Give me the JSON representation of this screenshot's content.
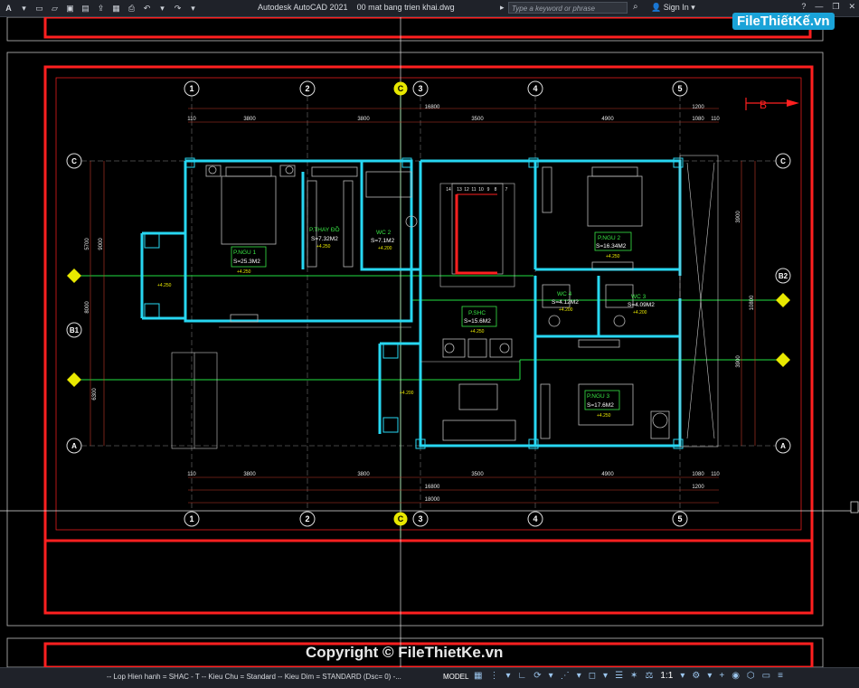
{
  "app": {
    "title": "Autodesk AutoCAD 2021",
    "filename": "00 mat bang trien khai.dwg",
    "search_placeholder": "Type a keyword or phrase",
    "sign_in": "Sign In"
  },
  "watermark": {
    "brand": "FileThiếtKế.vn",
    "copyright": "Copyright © FileThietKe.vn"
  },
  "drawing": {
    "grid_top": [
      "1",
      "2",
      "C",
      "3",
      "4",
      "5"
    ],
    "grid_side_left": [
      "C",
      "B1",
      "A"
    ],
    "grid_side_right": [
      "B2",
      "A"
    ],
    "section_marker": "B",
    "dims_top_total": "16800",
    "dims_top": [
      "110",
      "3800",
      "3800",
      "3500",
      "4900",
      "1200",
      "1080",
      "110"
    ],
    "dims_bottom": [
      "110",
      "3800",
      "3800",
      "3500",
      "4900",
      "1080",
      "110"
    ],
    "dims_bottom_total": [
      "16800",
      "18000"
    ],
    "dims_bottom_extra": "1200",
    "dims_left": [
      "5700",
      "8000",
      "9000",
      "6300"
    ],
    "dims_right": [
      "3900",
      "10800",
      "3900"
    ],
    "rooms": [
      {
        "name": "P.NGU 1",
        "area": "S=25.3M2",
        "level": "+4.250"
      },
      {
        "name": "P.THAY ĐỒ",
        "area": "S=7.32M2",
        "level": "+4.250"
      },
      {
        "name": "WC 2",
        "area": "S=7.1M2",
        "level": "+4.200"
      },
      {
        "name": "P.NGU 2",
        "area": "S=16.34M2",
        "level": "+4.250"
      },
      {
        "name": "P.SHC",
        "area": "S=15.6M2",
        "level": "+4.250"
      },
      {
        "name": "WC 4",
        "area": "S=4.12M2",
        "level": "+4.200"
      },
      {
        "name": "WC 3",
        "area": "S=4.09M2",
        "level": "+4.200"
      },
      {
        "name": "P.NGU 3",
        "area": "S=17.6M2",
        "level": "+4.250"
      }
    ],
    "other_levels": [
      "+4.250",
      "+4.200"
    ],
    "stair_numbers": [
      "14",
      "13",
      "12",
      "11",
      "10",
      "9",
      "8",
      "7"
    ]
  },
  "status": {
    "layer_info": "-- Lop Hien hanh = SHAC - T -- Kieu Chu = Standard -- Kieu Dim = STANDARD (Dsc= 0) -...",
    "model": "MODEL",
    "scale": "1:1"
  },
  "colors": {
    "frame_red": "#ff2020",
    "wall_cyan": "#27d7f2",
    "grid_green": "#22e042",
    "dim_red": "#c0392b",
    "label_green": "#39e645",
    "furniture": "#b9b9b9"
  }
}
